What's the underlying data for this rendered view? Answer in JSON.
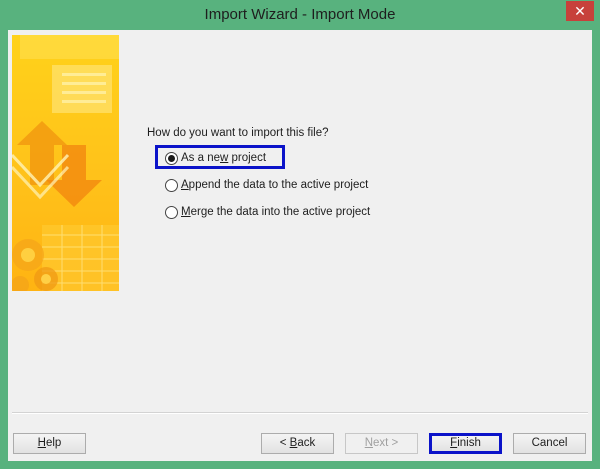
{
  "window": {
    "title": "Import Wizard - Import Mode",
    "close_glyph": "✕",
    "accent_color": "#58b27e",
    "highlight_color": "#0b13c9"
  },
  "main": {
    "question": "How do you want to import this file?",
    "options": [
      {
        "pre": "As a ne",
        "key": "w",
        "post": " project",
        "selected": true
      },
      {
        "pre": "",
        "key": "A",
        "post": "ppend the data to the active project",
        "selected": false
      },
      {
        "pre": "",
        "key": "M",
        "post": "erge the data into the active project",
        "selected": false
      }
    ]
  },
  "footer": {
    "help": {
      "key": "H",
      "post": "elp"
    },
    "back": {
      "pre": "< ",
      "key": "B",
      "post": "ack"
    },
    "next": {
      "key": "N",
      "post": "ext >",
      "disabled": true
    },
    "finish": {
      "key": "F",
      "post": "inish"
    },
    "cancel": "Cancel"
  }
}
